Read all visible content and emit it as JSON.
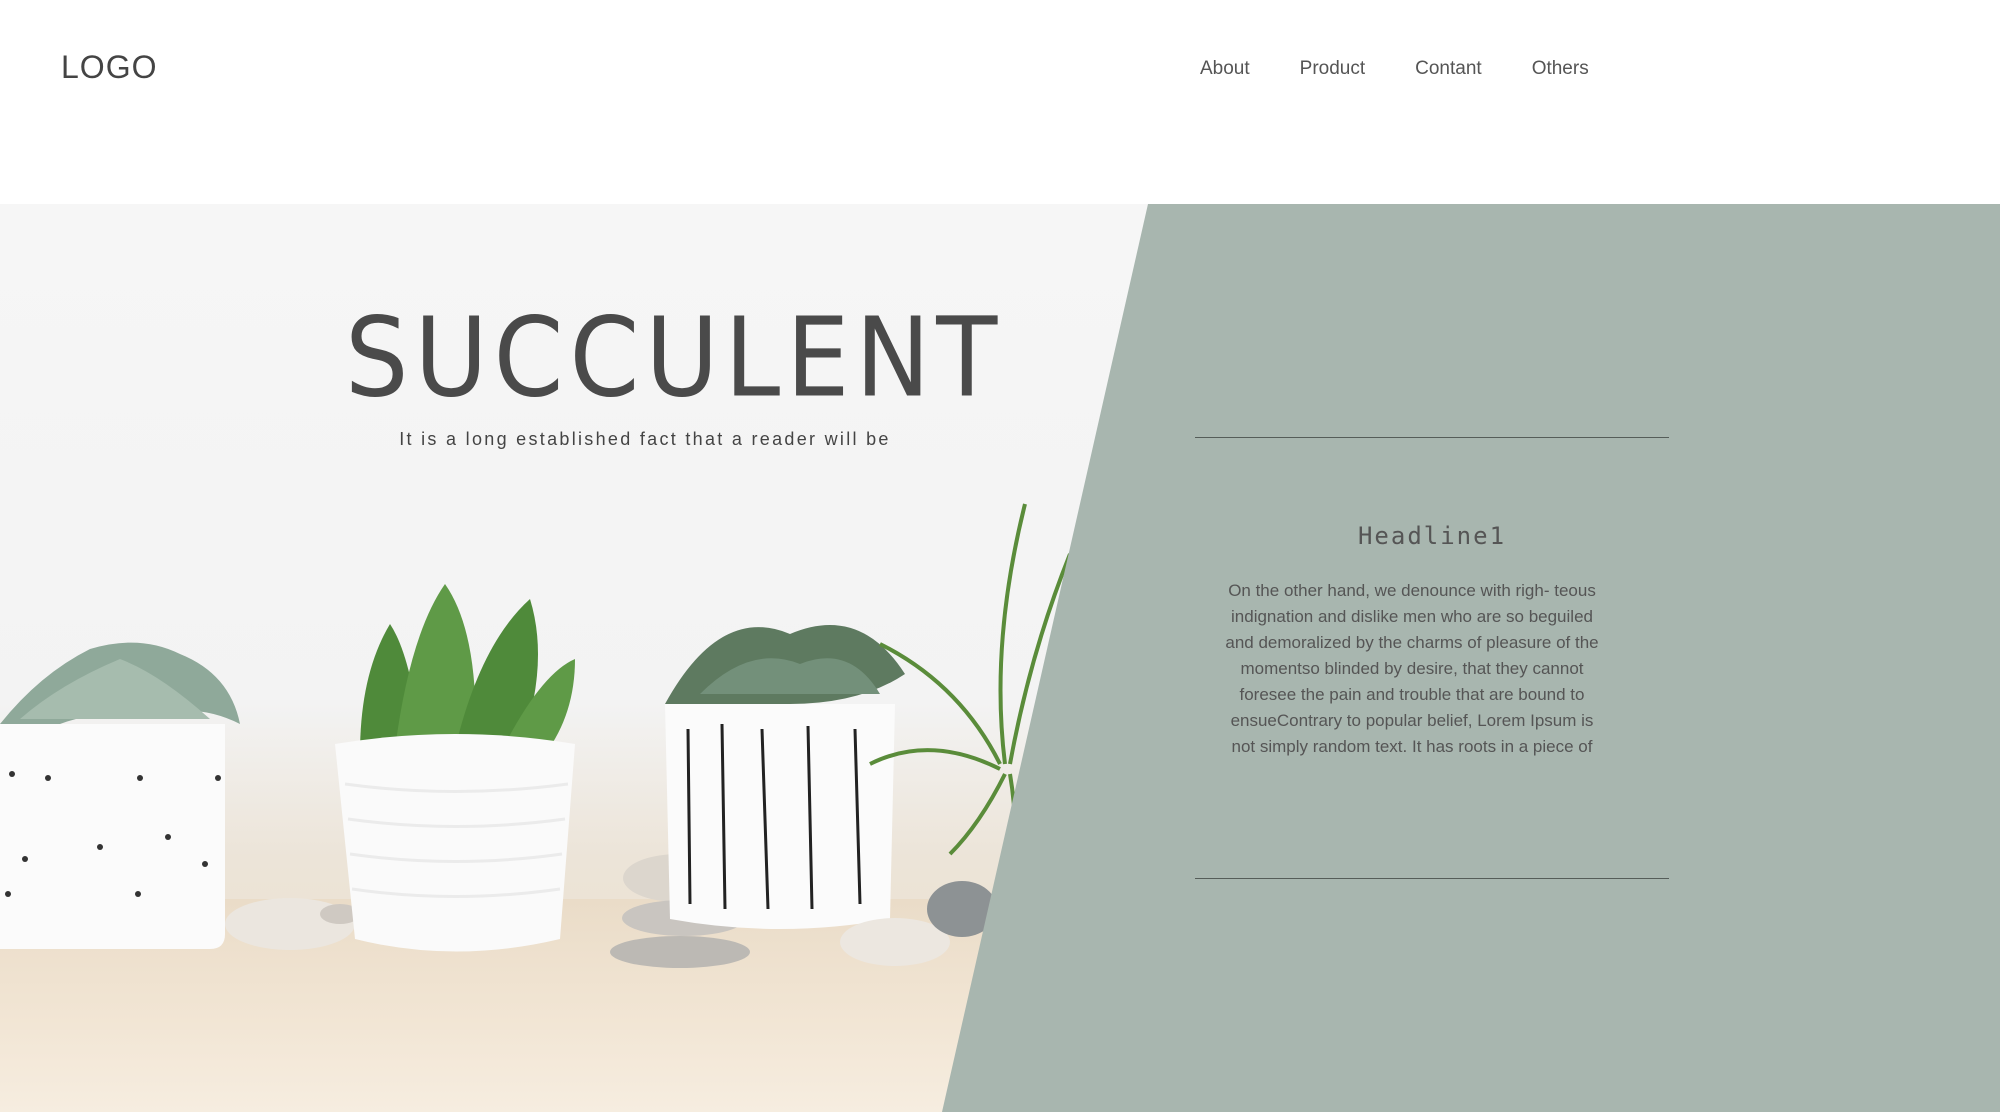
{
  "header": {
    "logo": "LOGO",
    "nav": [
      {
        "label": "About"
      },
      {
        "label": "Product"
      },
      {
        "label": "Contant"
      },
      {
        "label": "Others"
      }
    ]
  },
  "hero": {
    "title": "SUCCULENT",
    "subtitle": "It is a long established fact that a reader will be"
  },
  "panel": {
    "headline": "Headline1",
    "body": "On the other hand, we denounce with righ- teous indignation and dislike men who are so beguiled and demoralized by the charms of pleasure of the momentso blinded by desire, that they cannot foresee the pain and trouble that are bound to ensueContrary to popular belief, Lorem Ipsum is not simply random text. It has roots in a piece of"
  },
  "colors": {
    "panel": "#a8b6af",
    "text": "#4a4a4a"
  }
}
